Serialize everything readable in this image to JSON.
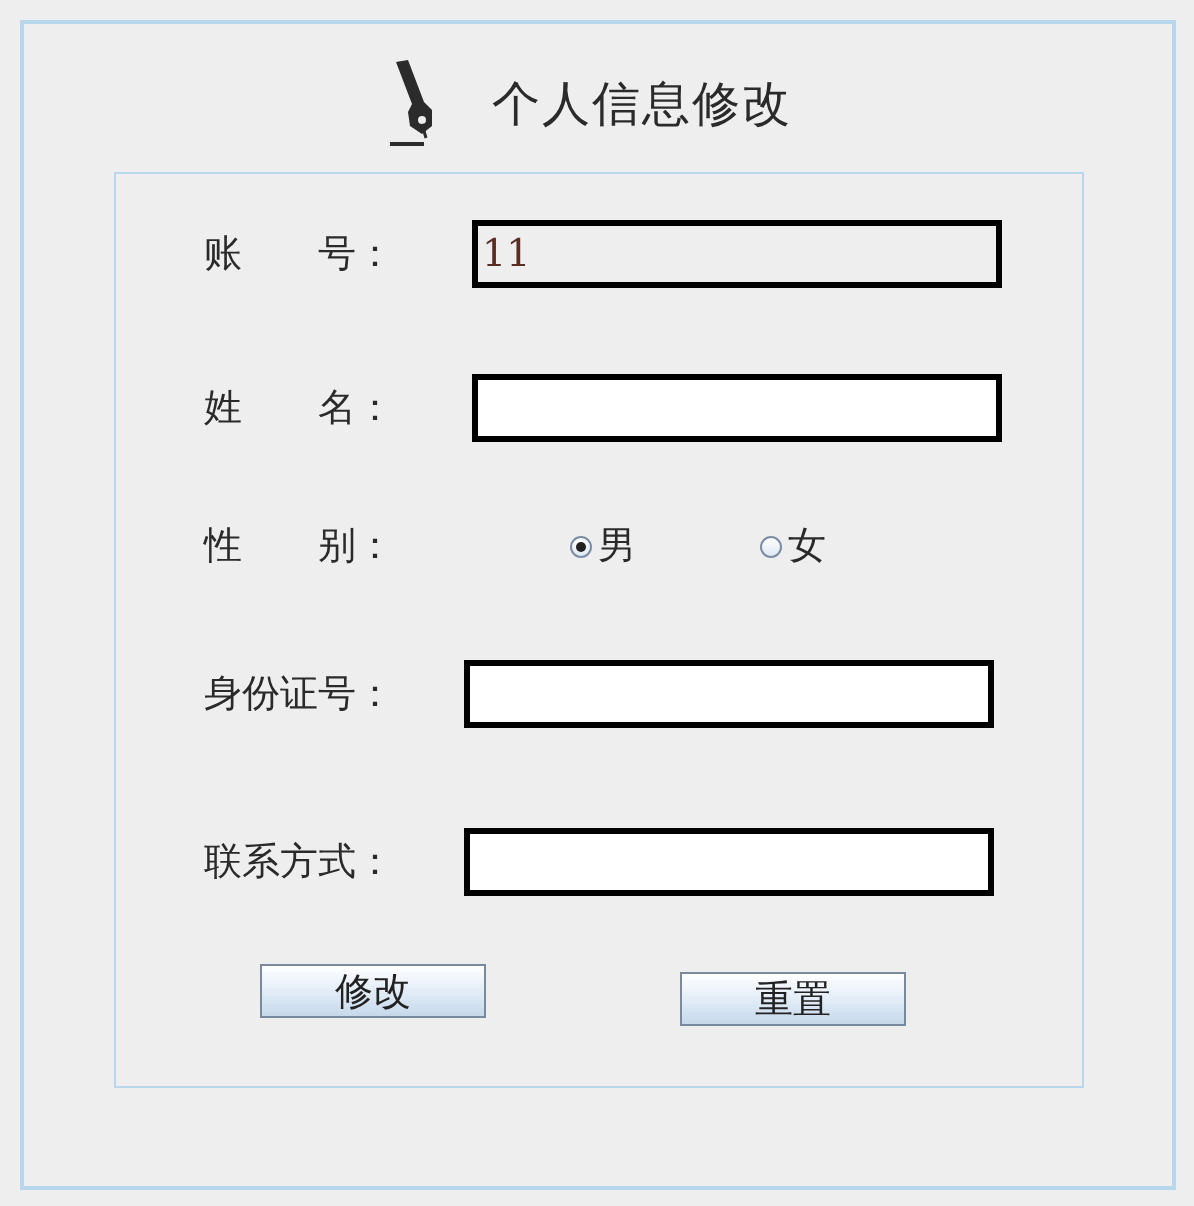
{
  "title": "个人信息修改",
  "fields": [
    {
      "kind": "text",
      "label": "账　　号：",
      "value": "11",
      "disabled": true
    },
    {
      "kind": "text",
      "label": "姓　　名：",
      "disabled": false
    },
    {
      "kind": "radio",
      "label": "性　　别：",
      "options": [
        {
          "label": "男",
          "selected": true
        },
        {
          "label": "女",
          "selected": false
        }
      ]
    },
    {
      "kind": "text",
      "label": "身份证号：",
      "disabled": false
    },
    {
      "kind": "text",
      "label": "联系方式：",
      "disabled": false
    }
  ],
  "buttons": [
    "修改",
    "重置"
  ]
}
